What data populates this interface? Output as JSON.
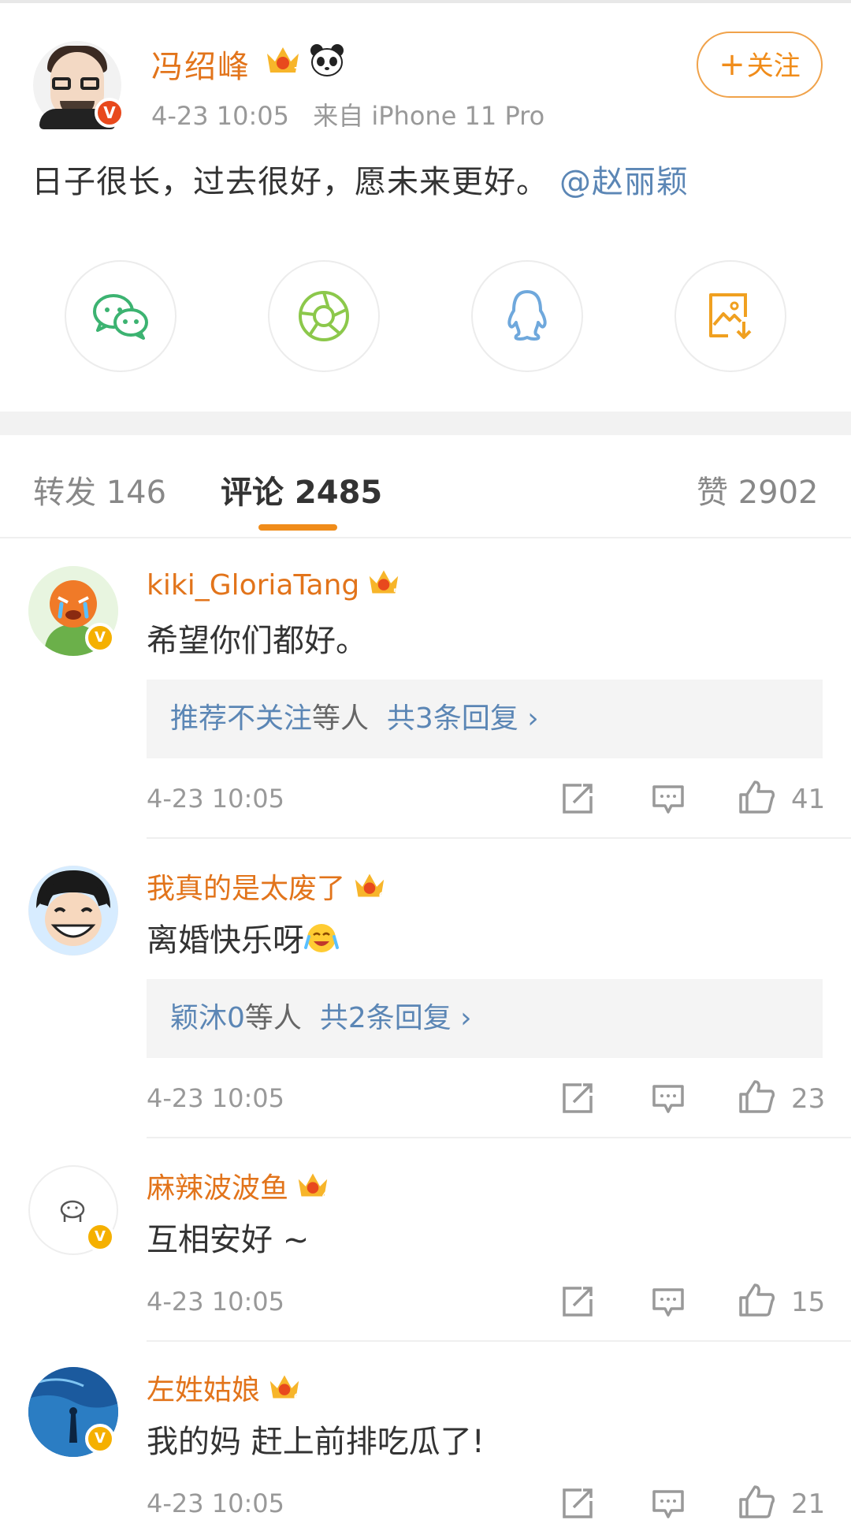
{
  "post": {
    "author": "冯绍峰",
    "time": "4-23 10:05",
    "source": "来自 iPhone 11 Pro",
    "text": "日子很长，过去很好，愿未来更好。",
    "mention": "@赵丽颖",
    "follow_plus": "+",
    "follow_label": "关注",
    "author_badge": "V",
    "author_level": "7"
  },
  "share": {
    "items": [
      "wechat-icon",
      "moments-icon",
      "qq-icon",
      "save-image-icon"
    ],
    "colors": {
      "wechat": "#3cb371",
      "moments": "#8cc84b",
      "qq": "#6fa8dc",
      "save": "#f0a020"
    }
  },
  "tabs": {
    "repost": "转发 146",
    "comments": "评论 2485",
    "likes": "赞 2902"
  },
  "accent": "#f08c1a",
  "comments": [
    {
      "name": "kiki_GloriaTang",
      "level": "5",
      "text": "希望你们都好。",
      "reply_users": "推荐不关注",
      "reply_mid": "等人",
      "reply_count": "共3条回复 ›",
      "time": "4-23 10:05",
      "likes": "41"
    },
    {
      "name": "我真的是太废了",
      "level": "6",
      "text": "离婚快乐呀",
      "reply_users": "颖沐0",
      "reply_mid": "等人",
      "reply_count": "共2条回复 ›",
      "time": "4-23 10:05",
      "likes": "23"
    },
    {
      "name": "麻辣波波鱼",
      "level": "4",
      "text": "互相安好 ~",
      "time": "4-23 10:05",
      "likes": "15"
    },
    {
      "name": "左姓姑娘",
      "level": "6",
      "text": "我的妈 赶上前排吃瓜了!",
      "time": "4-23 10:05",
      "likes": "21"
    }
  ],
  "verified_badge": "V"
}
